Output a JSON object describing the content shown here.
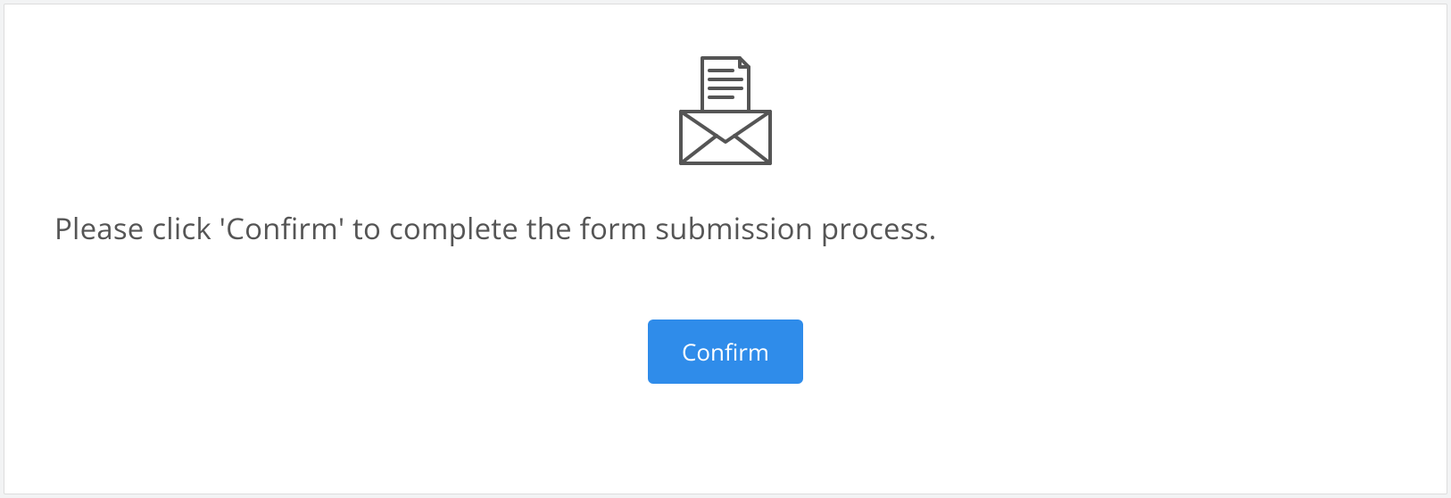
{
  "icon_name": "open-envelope-letter-icon",
  "message": "Please click 'Confirm' to complete the form submission process.",
  "button": {
    "label": "Confirm"
  },
  "colors": {
    "accent": "#2f8cea",
    "icon_stroke": "#555555"
  }
}
